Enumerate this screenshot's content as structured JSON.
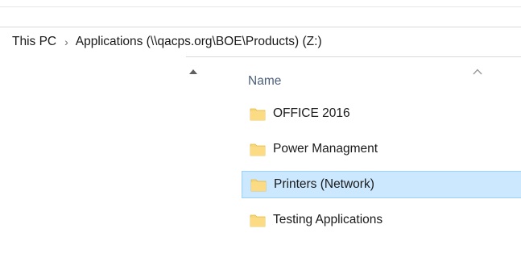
{
  "breadcrumb": {
    "items": [
      {
        "label": "This PC"
      },
      {
        "label": "Applications (\\\\qacps.org\\BOE\\Products) (Z:)"
      }
    ],
    "separator": "›"
  },
  "file_list": {
    "column_header": "Name",
    "sort_direction": "ascending",
    "items": [
      {
        "name": "OFFICE 2016",
        "selected": false,
        "icon": "folder-icon"
      },
      {
        "name": "Power Managment",
        "selected": false,
        "icon": "folder-icon"
      },
      {
        "name": "Printers (Network)",
        "selected": true,
        "icon": "folder-icon"
      },
      {
        "name": "Testing Applications",
        "selected": false,
        "icon": "folder-icon"
      }
    ]
  },
  "colors": {
    "selection_fill": "#cce8ff",
    "selection_border": "#99d1ff",
    "folder_fill": "#f8d775",
    "header_text": "#4c607a"
  }
}
